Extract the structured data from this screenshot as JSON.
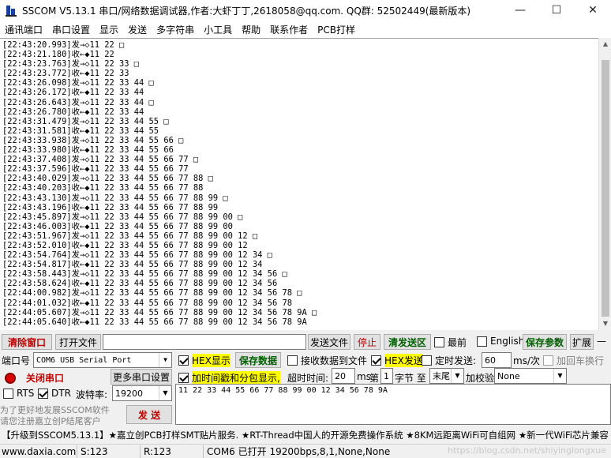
{
  "window": {
    "title": "SSCOM V5.13.1 串口/网络数据调试器,作者:大虾丁丁,2618058@qq.com. QQ群: 52502449(最新版本)",
    "minimize": "—",
    "maximize": "☐",
    "close": "✕"
  },
  "menu": [
    "通讯端口",
    "串口设置",
    "显示",
    "发送",
    "多字符串",
    "小工具",
    "帮助",
    "联系作者",
    "PCB打样"
  ],
  "log": [
    "[22:43:20.993]发→◇11 22 □",
    "[22:43:21.180]收←◆11 22",
    "[22:43:23.763]发→◇11 22 33 □",
    "[22:43:23.772]收←◆11 22 33",
    "[22:43:26.098]发→◇11 22 33 44 □",
    "[22:43:26.172]收←◆11 22 33 44",
    "[22:43:26.643]发→◇11 22 33 44 □",
    "[22:43:26.780]收←◆11 22 33 44",
    "[22:43:31.479]发→◇11 22 33 44 55 □",
    "[22:43:31.581]收←◆11 22 33 44 55",
    "[22:43:33.938]发→◇11 22 33 44 55 66 □",
    "[22:43:33.980]收←◆11 22 33 44 55 66",
    "[22:43:37.408]发→◇11 22 33 44 55 66 77 □",
    "[22:43:37.596]收←◆11 22 33 44 55 66 77",
    "[22:43:40.029]发→◇11 22 33 44 55 66 77 88 □",
    "[22:43:40.203]收←◆11 22 33 44 55 66 77 88",
    "[22:43:43.130]发→◇11 22 33 44 55 66 77 88 99 □",
    "[22:43:43.196]收←◆11 22 33 44 55 66 77 88 99",
    "[22:43:45.897]发→◇11 22 33 44 55 66 77 88 99 00 □",
    "[22:43:46.003]收←◆11 22 33 44 55 66 77 88 99 00",
    "[22:43:51.967]发→◇11 22 33 44 55 66 77 88 99 00 12 □",
    "[22:43:52.010]收←◆11 22 33 44 55 66 77 88 99 00 12",
    "[22:43:54.764]发→◇11 22 33 44 55 66 77 88 99 00 12 34 □",
    "[22:43:54.817]收←◆11 22 33 44 55 66 77 88 99 00 12 34",
    "[22:43:58.443]发→◇11 22 33 44 55 66 77 88 99 00 12 34 56 □",
    "[22:43:58.624]收←◆11 22 33 44 55 66 77 88 99 00 12 34 56",
    "[22:44:00.982]发→◇11 22 33 44 55 66 77 88 99 00 12 34 56 78 □",
    "[22:44:01.032]收←◆11 22 33 44 55 66 77 88 99 00 12 34 56 78",
    "[22:44:05.607]发→◇11 22 33 44 55 66 77 88 99 00 12 34 56 78 9A □",
    "[22:44:05.640]收←◆11 22 33 44 55 66 77 88 99 00 12 34 56 78 9A"
  ],
  "row1": {
    "clear_window": "清除窗口",
    "open_file": "打开文件",
    "file_path": "",
    "send_file": "发送文件",
    "stop": "停止",
    "clear_send": "清发送区",
    "topmost": "最前",
    "english": "English",
    "save_params": "保存参数",
    "expand": "扩展",
    "dash": "—"
  },
  "row2": {
    "port_label": "端口号",
    "port_value": "COM6 USB Serial Port",
    "hex_display": "HEX显示",
    "save_data": "保存数据",
    "recv_to_file": "接收数据到文件",
    "hex_send": "HEX发送",
    "timed_send": "定时发送:",
    "interval": "60",
    "interval_unit": "ms/次",
    "add_crlf": "加回车换行"
  },
  "row3": {
    "close_port": "关闭串口",
    "more_settings": "更多串口设置",
    "timestamp": "加时间戳和分包显示,",
    "timeout_label": "超时时间:",
    "timeout_value": "20",
    "timeout_unit": "ms",
    "nth_label": "第",
    "nth_value": "1",
    "byte_label": "字节 至",
    "end_value": "末尾",
    "checksum_label": "加校验",
    "checksum_value": "None"
  },
  "row4": {
    "rts": "RTS",
    "dtr": "DTR",
    "baud_label": "波特率:",
    "baud_value": "19200"
  },
  "side": {
    "promo_line1": "为了更好地发展SSCOM软件",
    "promo_line2": "请您注册嘉立创P结尾客户",
    "send": "发  送"
  },
  "send_text": "11 22 33 44 55 66 77 88 99 00 12 34 56 78 9A",
  "ticker": "【升级到SSCOM5.13.1】★嘉立创PCB打样SMT贴片服务. ★RT-Thread中国人的开源免费操作系统 ★8KM远距离WiFi可自组网 ★新一代WiFi芯片兼容",
  "status": {
    "site": "www.daxia.com",
    "sent": "S:123",
    "received": "R:123",
    "port_state": "COM6 已打开  19200bps,8,1,None,None",
    "watermark": "https://blog.csdn.net/shiyinglongxue"
  }
}
